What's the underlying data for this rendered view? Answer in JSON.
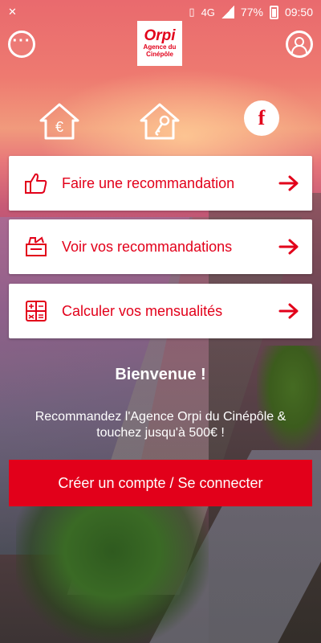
{
  "status_bar": {
    "battery": "77%",
    "time": "09:50",
    "network": "4G"
  },
  "header": {
    "logo_brand": "Orpi",
    "logo_subtitle_line1": "Agence du",
    "logo_subtitle_line2": "Cinépôle"
  },
  "quick_icons": [
    "euro-house-icon",
    "key-house-icon",
    "facebook-icon"
  ],
  "actions": [
    {
      "label": "Faire une recommandation",
      "icon": "thumbs-up-icon"
    },
    {
      "label": "Voir vos recommandations",
      "icon": "document-stack-icon"
    },
    {
      "label": "Calculer vos mensualités",
      "icon": "calculator-icon"
    }
  ],
  "welcome": {
    "title": "Bienvenue !",
    "text": "Recommandez l'Agence Orpi du Cinépôle & touchez jusqu'à 500€ !"
  },
  "cta": {
    "label": "Créer un compte / Se connecter"
  },
  "colors": {
    "brand_red": "#e2001a",
    "card_bg": "#ffffff"
  }
}
